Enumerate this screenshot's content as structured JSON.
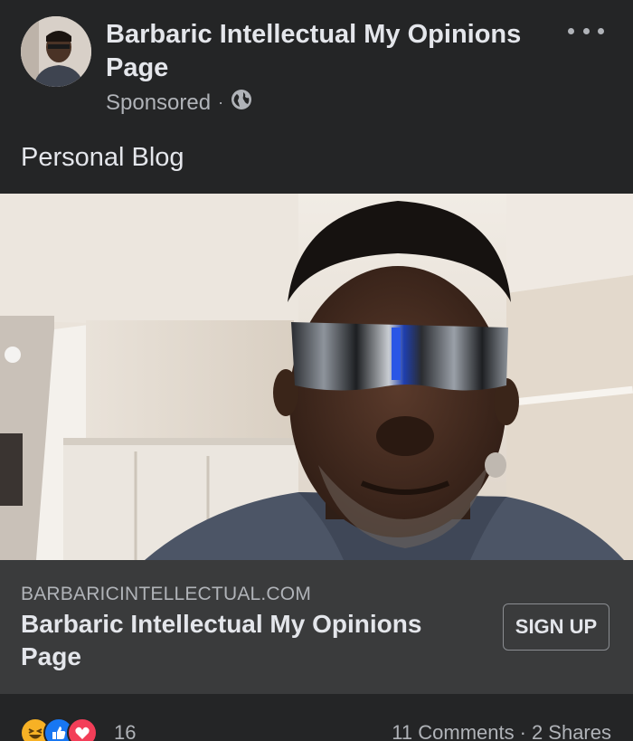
{
  "post": {
    "page_name": "Barbaric Intellectual My Opinions Page",
    "sponsored_label": "Sponsored",
    "separator": "·",
    "audience_icon": "globe-icon",
    "more_icon": "more-options-icon",
    "text": "Personal Blog"
  },
  "link_card": {
    "domain": "BARBARICINTELLECTUAL.COM",
    "title": "Barbaric Intellectual My Opinions Page",
    "cta_label": "SIGN UP"
  },
  "footer": {
    "reaction_icons": [
      "haha-icon",
      "like-icon",
      "love-icon"
    ],
    "reaction_count": "16",
    "comments": "11 Comments",
    "separator": "·",
    "shares": "2 Shares"
  },
  "colors": {
    "background": "#242526",
    "card": "#3a3b3c",
    "text_primary": "#e4e6eb",
    "text_secondary": "#b0b3b8",
    "like_blue": "#1877f2",
    "love_red": "#f33e58",
    "haha_yellow": "#f7b125"
  }
}
